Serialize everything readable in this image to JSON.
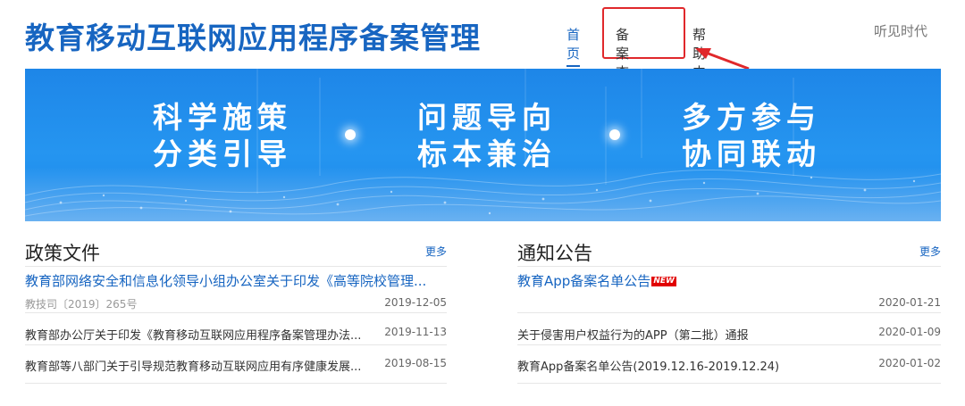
{
  "header": {
    "site_title": "教育移动互联网应用程序备案管理",
    "nav": {
      "home": "首页",
      "query": "备案查询",
      "help": "帮助中心"
    },
    "watermark": "听见时代"
  },
  "banner": {
    "slogans": [
      {
        "line1": "科学施策",
        "line2": "分类引导"
      },
      {
        "line1": "问题导向",
        "line2": "标本兼治"
      },
      {
        "line1": "多方参与",
        "line2": "协同联动"
      }
    ]
  },
  "policy": {
    "title": "政策文件",
    "more": "更多",
    "items": [
      {
        "title": "教育部网络安全和信息化领导小组办公室关于印发《高等院校管理...",
        "sub": "教技司〔2019〕265号",
        "date": "2019-12-05"
      },
      {
        "title": "教育部办公厅关于印发《教育移动互联网应用程序备案管理办法...",
        "date": "2019-11-13"
      },
      {
        "title": "教育部等八部门关于引导规范教育移动互联网应用有序健康发展...",
        "date": "2019-08-15"
      }
    ]
  },
  "notice": {
    "title": "通知公告",
    "more": "更多",
    "new_badge": "NEW",
    "items": [
      {
        "title": "教育App备案名单公告",
        "date": "2020-01-21"
      },
      {
        "title": "关于侵害用户权益行为的APP（第二批）通报",
        "date": "2020-01-09"
      },
      {
        "title": "教育App备案名单公告(2019.12.16-2019.12.24)",
        "date": "2020-01-02"
      }
    ]
  },
  "colors": {
    "brand_blue": "#1765c1",
    "highlight_red": "#e0282b",
    "banner_blue": "#2595f0"
  }
}
